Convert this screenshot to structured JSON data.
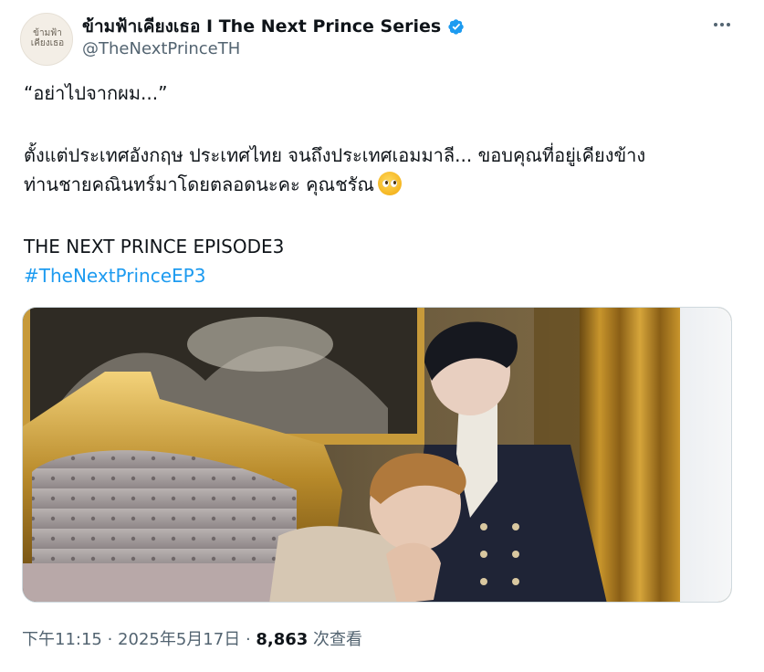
{
  "author": {
    "display_name": "ข้ามฟ้าเคียงเธอ I The Next Prince Series",
    "handle": "@TheNextPrinceTH",
    "avatar_logo_line1": "ข้ามฟ้า",
    "avatar_logo_line2": "เคียงเธอ",
    "verified_color": "#1d9bf0"
  },
  "tweet": {
    "line1": "“อย่าไปจากผม...”",
    "line2": "ตั้งแต่ประเทศอังกฤษ ประเทศไทย จนถึงประเทศเอมมาลี... ขอบคุณที่อยู่เคียงข้าง",
    "line3": "ท่านชายคณินทร์มาโดยตลอดนะคะ คุณชรัณ",
    "emoji": "pleading-face",
    "line4": "THE NEXT PRINCE EPISODE3",
    "hashtag": "#TheNextPrinceEP3",
    "link_color": "#1d9bf0"
  },
  "meta": {
    "time": "下午11:15",
    "sep1": " · ",
    "date": "2025年5月17日",
    "sep2": " · ",
    "views_count": "8,863",
    "views_label": " 次查看"
  },
  "icons": {
    "more": "more-horizontal-icon",
    "verified": "verified-badge-icon"
  }
}
